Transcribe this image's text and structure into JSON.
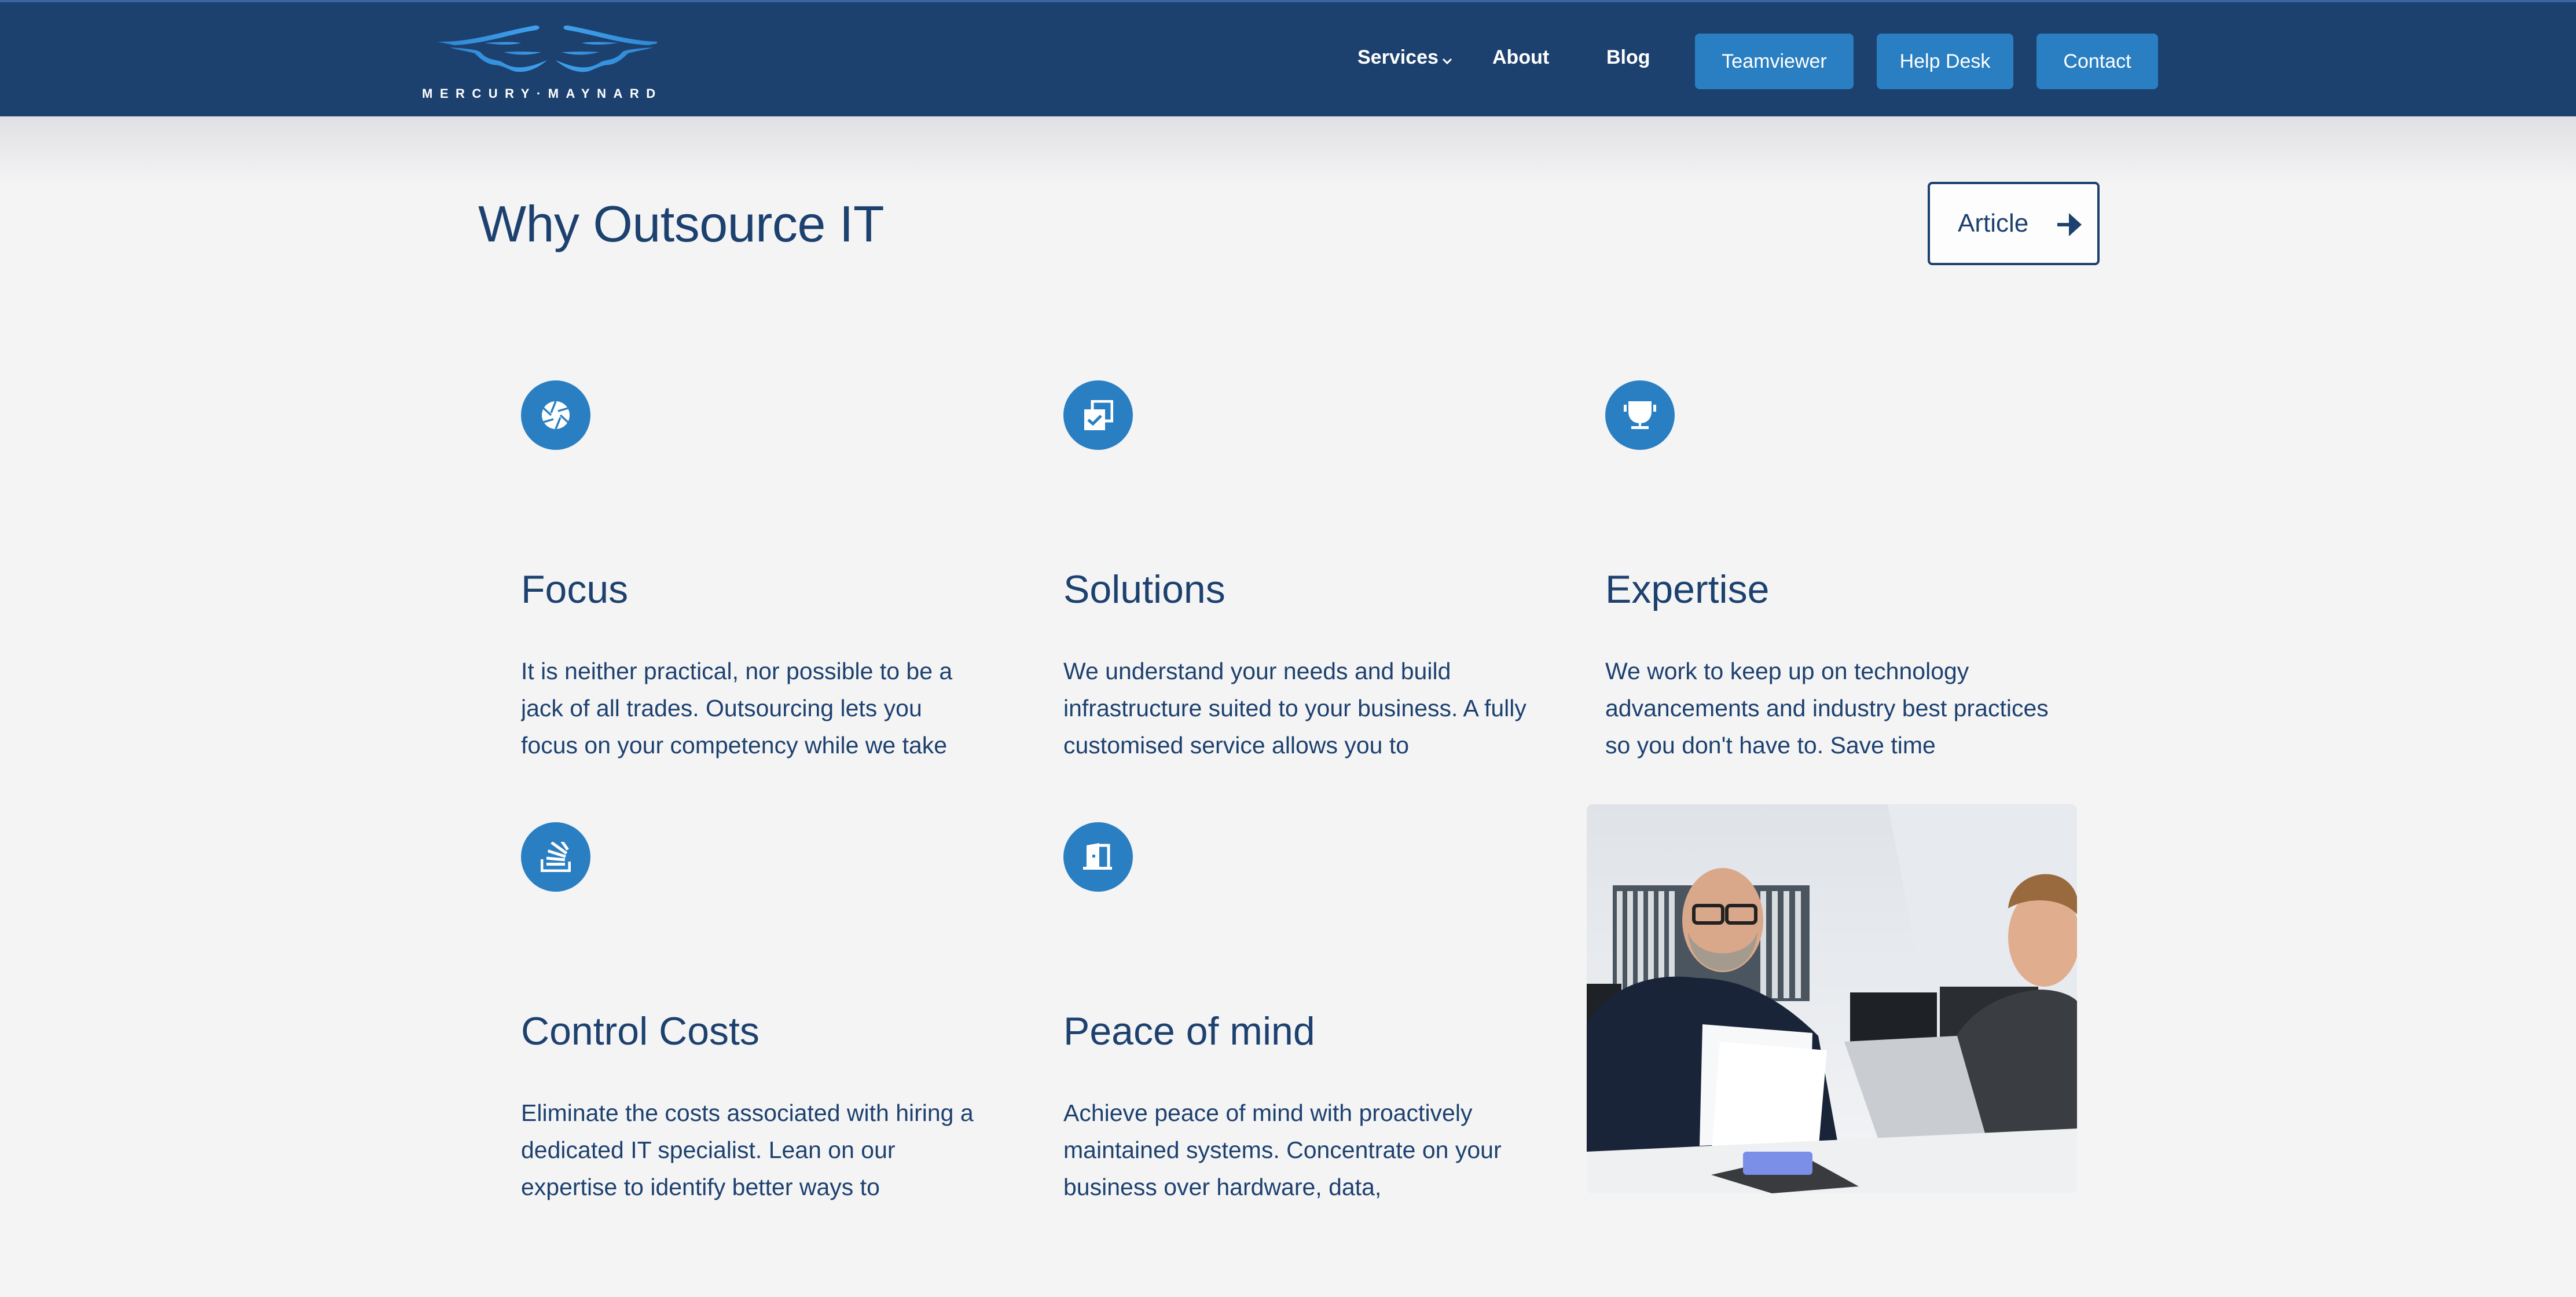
{
  "brand": {
    "name": "MERCURY·MAYNARD",
    "logo_icon": "winged-logo-icon",
    "colors": {
      "header_bg": "#1d416f",
      "accent": "#2a7fc2",
      "wing": "#3390da",
      "text": "#1d416f",
      "page_bg": "#f4f4f5"
    }
  },
  "nav": {
    "links": [
      {
        "label": "Services",
        "has_dropdown": true,
        "icon": "chevron-down-icon"
      },
      {
        "label": "About"
      },
      {
        "label": "Blog"
      }
    ],
    "buttons": [
      {
        "label": "Teamviewer"
      },
      {
        "label": "Help Desk"
      },
      {
        "label": "Contact"
      }
    ]
  },
  "section": {
    "title": "Why Outsource IT",
    "article_button": {
      "label": "Article",
      "icon": "arrow-right-icon"
    }
  },
  "features": [
    {
      "icon": "aperture-icon",
      "title": "Focus",
      "description": "It is neither practical, nor possible to be a jack of all trades. Outsourcing lets you focus on your competency while we take care of the rest."
    },
    {
      "icon": "checked-copy-icon",
      "title": "Solutions",
      "description": "We understand your needs and build infrastructure suited to your business. A fully customised service allows you to"
    },
    {
      "icon": "trophy-icon",
      "title": "Expertise",
      "description": "We work to keep up on technology advancements and industry best practices so you don't have to. Save time"
    },
    {
      "icon": "stack-tray-icon",
      "title": "Control Costs",
      "description": "Eliminate the costs associated with hiring a dedicated IT specialist. Lean on our expertise to identify better ways to"
    },
    {
      "icon": "open-door-icon",
      "title": "Peace of mind",
      "description": "Achieve peace of mind with proactively maintained systems. Concentrate on your business over hardware, data,"
    }
  ],
  "photo": {
    "alt": "Two Mercury Maynard staff members at a desk reviewing documents and a laptop"
  }
}
